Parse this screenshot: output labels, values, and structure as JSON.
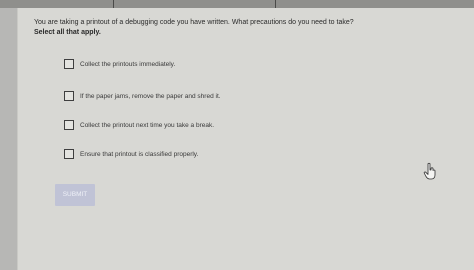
{
  "question": {
    "text": "You are taking a printout of a debugging code you have written. What precautions do you need to take?",
    "instruction": "Select all that apply."
  },
  "options": [
    {
      "label": "Collect the printouts immediately.",
      "checked": false
    },
    {
      "label": "If the paper jams, remove the paper and shred it.",
      "checked": false
    },
    {
      "label": "Collect the printout next time you take a break.",
      "checked": false
    },
    {
      "label": "Ensure that printout is classified properly.",
      "checked": false
    }
  ],
  "submit": {
    "label": "SUBMIT",
    "enabled": false
  },
  "cursor": {
    "icon": "hand-pointer-icon"
  }
}
